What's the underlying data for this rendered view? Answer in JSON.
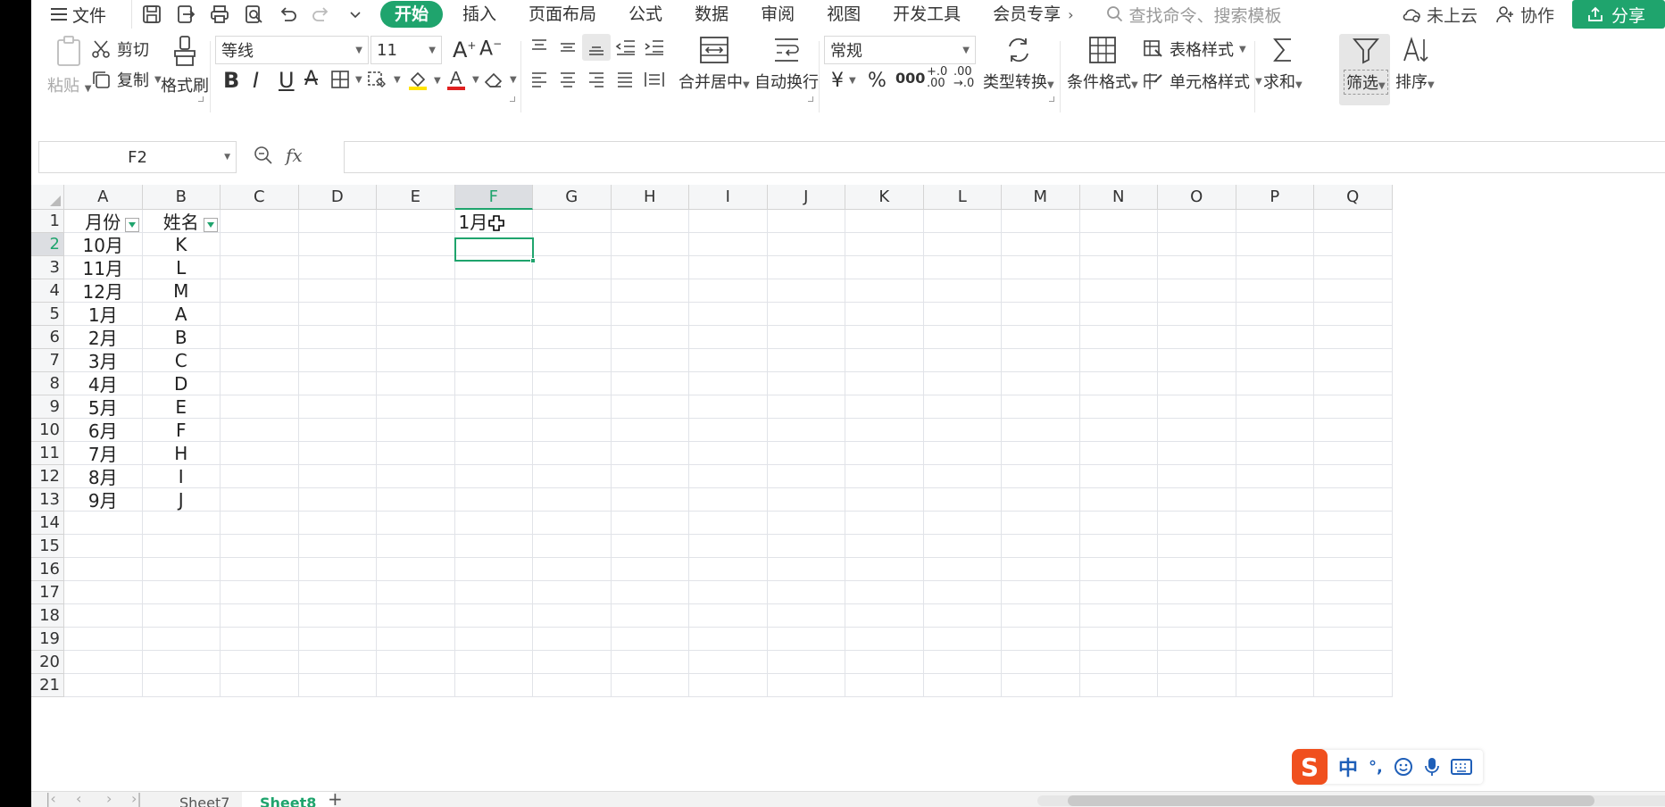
{
  "menubar": {
    "file_label": "文件",
    "tabs": [
      "开始",
      "插入",
      "页面布局",
      "公式",
      "数据",
      "审阅",
      "视图",
      "开发工具",
      "会员专享"
    ],
    "more": "›",
    "search_placeholder": "查找命令、搜索模板",
    "cloud_label": "未上云",
    "collab_label": "协作",
    "share_label": "分享"
  },
  "ribbon": {
    "paste": "粘贴",
    "cut": "剪切",
    "copy": "复制",
    "format_painter": "格式刷",
    "font_name": "等线",
    "font_size": "11",
    "number_format": "常规",
    "merge_center": "合并居中",
    "wrap_text": "自动换行",
    "type_convert": "类型转换",
    "conditional_format": "条件格式",
    "table_style": "表格样式",
    "cell_style": "单元格样式",
    "sum": "求和",
    "filter": "筛选",
    "sort": "排序",
    "bold": "B",
    "italic": "I",
    "underline": "U",
    "currency": "¥",
    "percent": "%",
    "thousands": "000",
    "inc_decimal": "+.0\n.00",
    "dec_decimal": ".00\n→.0"
  },
  "formula_bar": {
    "name_box": "F2",
    "fx": "fx",
    "value": ""
  },
  "columns": [
    "A",
    "B",
    "C",
    "D",
    "E",
    "F",
    "G",
    "H",
    "I",
    "J",
    "K",
    "L",
    "M",
    "N",
    "O",
    "P",
    "Q"
  ],
  "rows": [
    "1",
    "2",
    "3",
    "4",
    "5",
    "6",
    "7",
    "8",
    "9",
    "10",
    "11",
    "12",
    "13",
    "14",
    "15",
    "16",
    "17",
    "18",
    "19",
    "20",
    "21"
  ],
  "selected": {
    "column": "F",
    "row": "2"
  },
  "cells": {
    "A": [
      "月份",
      "10月",
      "11月",
      "12月",
      "1月",
      "2月",
      "3月",
      "4月",
      "5月",
      "6月",
      "7月",
      "8月",
      "9月"
    ],
    "B": [
      "姓名",
      "K",
      "L",
      "M",
      "A",
      "B",
      "C",
      "D",
      "E",
      "F",
      "H",
      "I",
      "J"
    ],
    "F1": "1月"
  },
  "sheets": [
    "Sheet7",
    "Sheet8"
  ],
  "ime": {
    "logo": "S",
    "mode": "中",
    "punct": "°,"
  },
  "colors": {
    "accent": "#1fa46d",
    "ime": "#f0501e"
  }
}
